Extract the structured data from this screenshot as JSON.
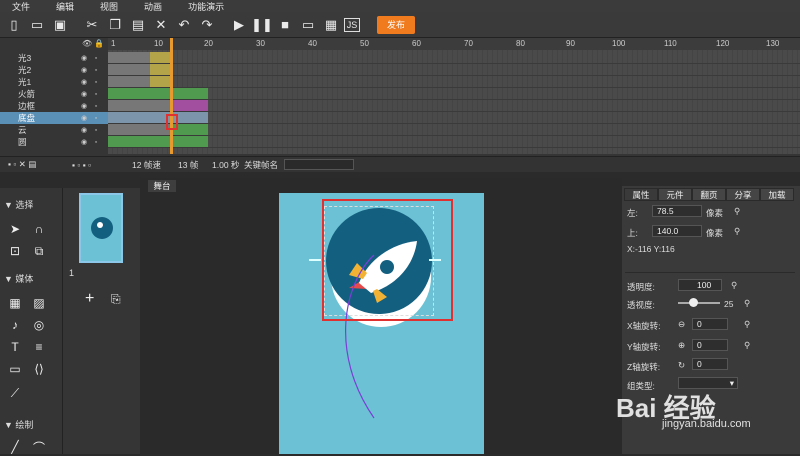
{
  "menu": [
    "文件",
    "编辑",
    "视图",
    "动画",
    "功能演示"
  ],
  "toolbar": {
    "publish_label": "发布",
    "icons": [
      "new-file-icon",
      "open-folder-icon",
      "save-icon",
      "cut-icon",
      "copy-icon",
      "paste-icon",
      "delete-icon",
      "undo-icon",
      "redo-icon",
      "play-icon",
      "pause-icon",
      "stop-icon",
      "preview-icon",
      "qr-code-icon",
      "js-icon"
    ]
  },
  "timeline": {
    "ruler_ticks": [
      "1",
      "10",
      "20",
      "30",
      "40",
      "50",
      "60",
      "70",
      "80",
      "90",
      "100",
      "110",
      "120",
      "130"
    ],
    "layers": [
      {
        "name": "光3"
      },
      {
        "name": "光2"
      },
      {
        "name": "光1"
      },
      {
        "name": "火箭"
      },
      {
        "name": "边框"
      },
      {
        "name": "底盘"
      },
      {
        "name": "云"
      },
      {
        "name": "圆"
      }
    ],
    "selected_layer": "底盘",
    "status": {
      "fps": "12 帧速",
      "frame": "13 帧",
      "time": "1.00 秒",
      "keyframe_label": "关键帧名"
    }
  },
  "left_panel": {
    "section_select": "▼ 选择",
    "section_media": "▼ 媒体",
    "section_draw": "▼ 绘制"
  },
  "thumbs": {
    "page_number": "1"
  },
  "stage": {
    "tab_label": "舞台"
  },
  "props": {
    "tabs": [
      "属性",
      "元件",
      "翻页",
      "分享",
      "加载"
    ],
    "left_label": "左:",
    "left_value": "78.5",
    "top_label": "上:",
    "top_value": "140.0",
    "unit": "像素",
    "xy": "X:-116   Y:116",
    "opacity_label": "透明度:",
    "opacity_value": "100",
    "perspective_label": "透视度:",
    "perspective_value": "25",
    "xrot_label": "X轴旋转:",
    "xrot_value": "0",
    "yrot_label": "Y轴旋转:",
    "yrot_value": "0",
    "zrot_label": "Z轴旋转:",
    "zrot_value": "0",
    "group_label": "组类型:"
  },
  "watermark": {
    "brand": "Bai 经验",
    "url": "jingyan.baidu.com"
  },
  "colors": {
    "accent_orange": "#f07b1f",
    "selection_blue": "#5a8fb6",
    "canvas_cyan": "#6cc2d4",
    "highlight_red": "#e03030"
  }
}
